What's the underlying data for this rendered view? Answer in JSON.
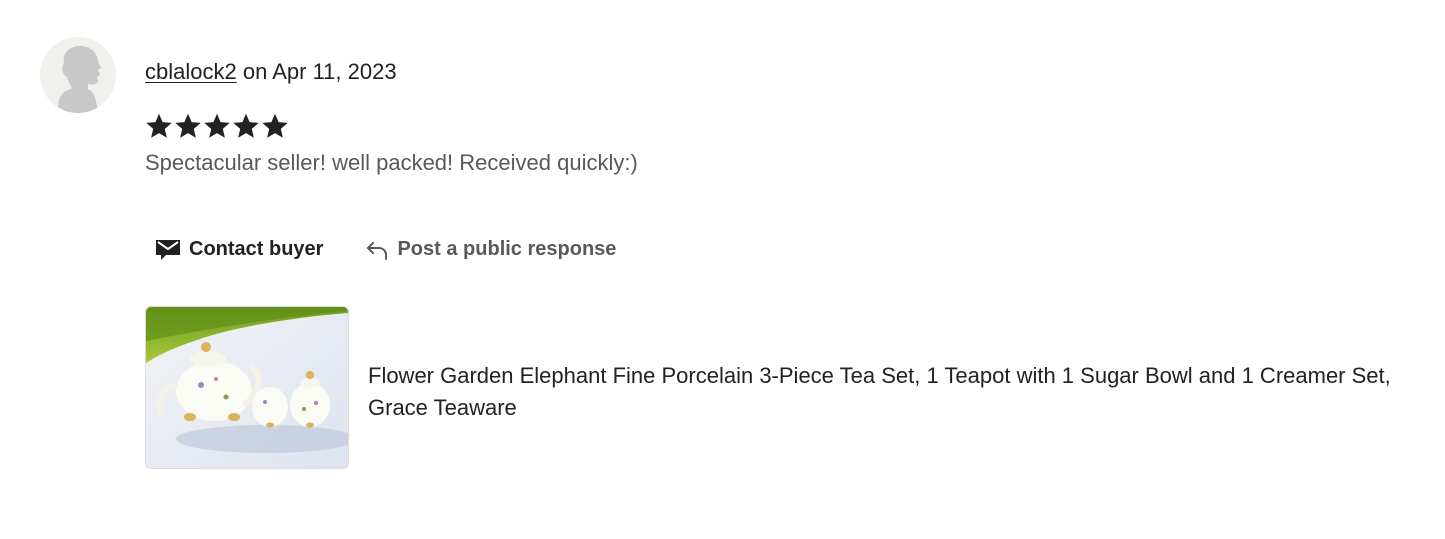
{
  "review": {
    "reviewer_name": "cblalock2",
    "date_prefix": "on",
    "date": "Apr 11, 2023",
    "rating": 5,
    "rating_max": 5,
    "text": "Spectacular seller! well packed! Received quickly:)"
  },
  "actions": {
    "contact_label": "Contact buyer",
    "contact_icon": "envelope-icon",
    "respond_label": "Post a public response",
    "respond_icon": "reply-arrow-icon"
  },
  "listing": {
    "title": "Flower Garden Elephant Fine Porcelain 3-Piece Tea Set, 1 Teapot with 1 Sugar Bowl and 1 Creamer Set, Grace Teaware"
  },
  "colors": {
    "text_primary": "#222222",
    "text_secondary": "#595959",
    "avatar_bg": "#f0f0ec",
    "avatar_silhouette": "#c8c8c8",
    "star": "#222222"
  }
}
